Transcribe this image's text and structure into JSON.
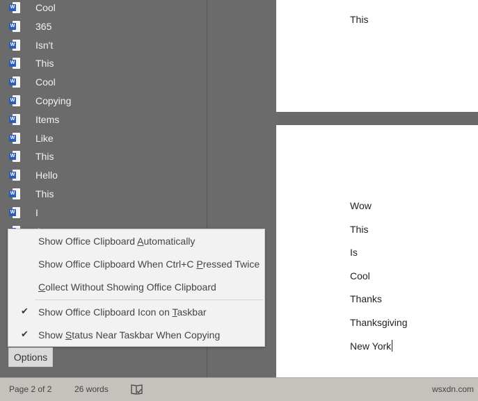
{
  "clipboard_items": [
    {
      "label": "Cool",
      "icon": "word-doc-icon"
    },
    {
      "label": "365",
      "icon": "word-doc-icon"
    },
    {
      "label": "Isn't",
      "icon": "word-doc-icon"
    },
    {
      "label": "This",
      "icon": "word-doc-icon"
    },
    {
      "label": "Cool",
      "icon": "word-doc-icon"
    },
    {
      "label": "Copying",
      "icon": "word-doc-icon"
    },
    {
      "label": "Items",
      "icon": "word-doc-icon"
    },
    {
      "label": "Like",
      "icon": "word-doc-icon"
    },
    {
      "label": "This",
      "icon": "word-doc-icon"
    },
    {
      "label": "Hello",
      "icon": "word-doc-icon"
    },
    {
      "label": "This",
      "icon": "word-doc-icon"
    },
    {
      "label": "I",
      "icon": "word-doc-icon"
    },
    {
      "label": "A",
      "icon": "word-doc-icon"
    }
  ],
  "options_menu": {
    "items": [
      {
        "pre": "Show Office Clipboard ",
        "key": "A",
        "post": "utomatically",
        "checked": false
      },
      {
        "pre": "Show Office Clipboard When Ctrl+C ",
        "key": "P",
        "post": "ressed Twice",
        "checked": false
      },
      {
        "pre": "",
        "key": "C",
        "post": "ollect Without Showing Office Clipboard",
        "checked": false
      },
      {
        "pre": "Show Office Clipboard Icon on ",
        "key": "T",
        "post": "askbar",
        "checked": true
      },
      {
        "pre": "Show ",
        "key": "S",
        "post": "tatus Near Taskbar When Copying",
        "checked": true
      }
    ],
    "check_glyph": "✔"
  },
  "options_button": "Options",
  "document": {
    "page1_lines": [
      "This"
    ],
    "page2_lines": [
      "Wow",
      "This",
      "Is",
      "Cool",
      "Thanks",
      "Thanksgiving",
      "New York"
    ]
  },
  "status_bar": {
    "page": "Page 2 of 2",
    "words": "26 words",
    "proofing_icon": "book-check-icon",
    "watermark": "wsxdn.com"
  }
}
